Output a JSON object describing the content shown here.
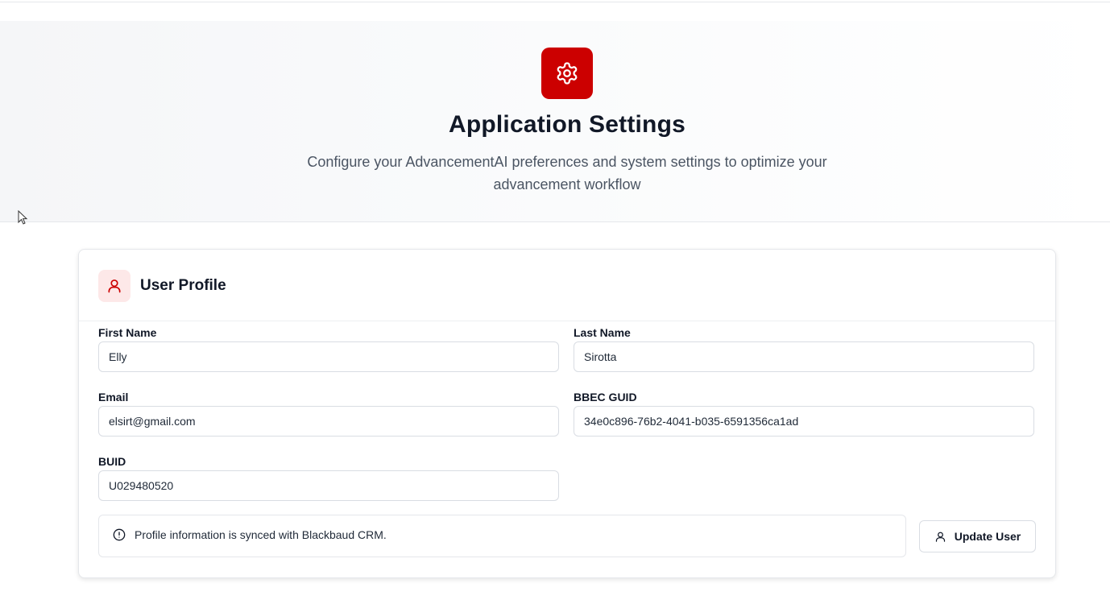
{
  "header": {
    "title": "Application Settings",
    "subtitle_line1": "Configure your AdvancementAI preferences and system settings to optimize your",
    "subtitle_line2": "advancement workflow",
    "icon": "gear-icon"
  },
  "profile": {
    "title": "User Profile",
    "icon": "user-icon",
    "fields": {
      "first_name": {
        "label": "First Name",
        "value": "Elly"
      },
      "last_name": {
        "label": "Last Name",
        "value": "Sirotta"
      },
      "email": {
        "label": "Email",
        "value": "elsirt@gmail.com"
      },
      "bbec_guid": {
        "label": "BBEC GUID",
        "value": "34e0c896-76b2-4041-b035-6591356ca1ad"
      },
      "buid": {
        "label": "BUID",
        "value": "U029480520"
      }
    },
    "notice": "Profile information is synced with Blackbaud CRM.",
    "update_button": "Update User"
  },
  "colors": {
    "accent": "#cc0000",
    "accent_soft": "#fde8e8",
    "text": "#111827",
    "muted": "#4b5563",
    "border": "#e5e7eb"
  }
}
